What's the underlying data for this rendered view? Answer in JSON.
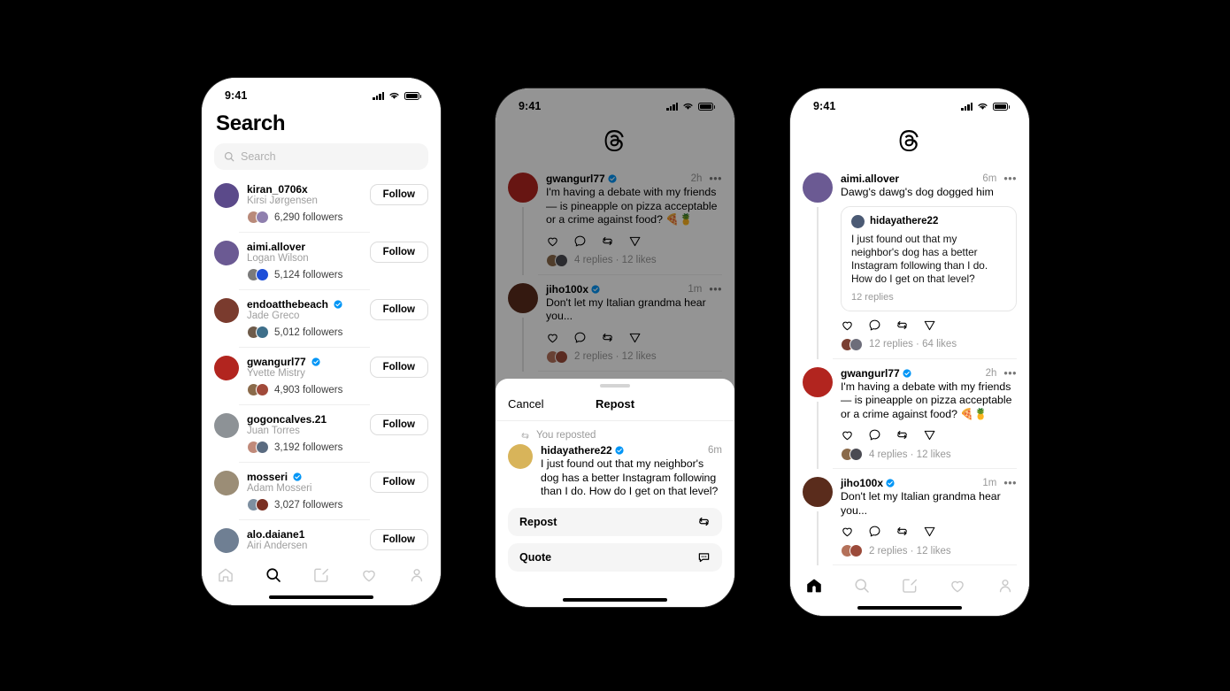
{
  "meta": {
    "app_name": "Threads",
    "background": "#000000",
    "accent_verified": "#0095f6"
  },
  "status_bar": {
    "time": "9:41",
    "cellular": "signal-bars",
    "wifi": "wifi",
    "battery": "battery-full"
  },
  "phone1": {
    "screen_title": "Search",
    "search": {
      "placeholder": "Search",
      "value": ""
    },
    "results": [
      {
        "username": "kiran_0706x",
        "fullname": "Kirsi Jørgensen",
        "followers": "6,290 followers",
        "verified": false,
        "follow_label": "Follow",
        "avatar": "#5b4a8a",
        "face1": "#b98a7a",
        "face2": "#8f7fae"
      },
      {
        "username": "aimi.allover",
        "fullname": "Logan Wilson",
        "followers": "5,124 followers",
        "verified": false,
        "follow_label": "Follow",
        "avatar": "#6b5a93",
        "face1": "#7a7a7a",
        "face2": "#1d4ed8"
      },
      {
        "username": "endoatthebeach",
        "fullname": "Jade Greco",
        "followers": "5,012 followers",
        "verified": true,
        "follow_label": "Follow",
        "avatar": "#7a3b2e",
        "face1": "#6e5b4a",
        "face2": "#3e6f8a"
      },
      {
        "username": "gwangurl77",
        "fullname": "Yvette Mistry",
        "followers": "4,903 followers",
        "verified": true,
        "follow_label": "Follow",
        "avatar": "#b2251f",
        "face1": "#8a6a4a",
        "face2": "#a14a3a"
      },
      {
        "username": "gogoncalves.21",
        "fullname": "Juan Torres",
        "followers": "3,192 followers",
        "verified": false,
        "follow_label": "Follow",
        "avatar": "#8d9296",
        "face1": "#c08a7a",
        "face2": "#5a6b80"
      },
      {
        "username": "mosseri",
        "fullname": "Adam Mosseri",
        "followers": "3,027 followers",
        "verified": true,
        "follow_label": "Follow",
        "avatar": "#9b8d76",
        "face1": "#7d8fa0",
        "face2": "#7a2f22"
      },
      {
        "username": "alo.daiane1",
        "fullname": "Airi Andersen",
        "followers": "",
        "verified": false,
        "follow_label": "Follow",
        "avatar": "#6f7f93",
        "face1": "#999",
        "face2": "#888"
      }
    ],
    "tabbar": [
      "home-icon",
      "search-icon",
      "compose-icon",
      "activity-icon",
      "profile-icon"
    ],
    "active_tab": "search-icon"
  },
  "phone2": {
    "logo": "threads-logo",
    "posts": [
      {
        "username": "gwangurl77",
        "verified": true,
        "time": "2h",
        "text": "I'm having a debate with my friends — is pineapple on pizza acceptable or a crime against food? 🍕🍍",
        "stats": "4 replies · 12 likes",
        "avatar": "#b2251f",
        "face1": "#8a6a4a",
        "face2": "#4a4a52"
      },
      {
        "username": "jiho100x",
        "verified": true,
        "time": "1m",
        "text": "Don't let my Italian grandma hear you...",
        "stats": "2 replies · 12 likes",
        "avatar": "#5a2c1c",
        "face1": "#b4715a",
        "face2": "#9b4a3a"
      },
      {
        "username": "hidayathere22",
        "verified": false,
        "time": "6m",
        "text": "I just found out that my neighbor's dog has a",
        "stats": "",
        "avatar": "#2f3b52",
        "face1": "#888",
        "face2": "#888"
      }
    ],
    "sheet": {
      "cancel_label": "Cancel",
      "title": "Repost",
      "reposted_label": "You reposted",
      "post": {
        "username": "hidayathere22",
        "verified": true,
        "time": "6m",
        "text": "I just found out that my neighbor's dog has a better Instagram following than I do. How do I get on that level?",
        "avatar": "#d8b45a"
      },
      "options": [
        {
          "label": "Repost",
          "icon": "repost-icon"
        },
        {
          "label": "Quote",
          "icon": "quote-icon"
        }
      ]
    }
  },
  "phone3": {
    "logo": "threads-logo",
    "posts": [
      {
        "username": "aimi.allover",
        "verified": false,
        "time": "6m",
        "text": "Dawg's dawg's dog dogged him",
        "stats": "12 replies · 64 likes",
        "avatar": "#6b5a93",
        "face1": "#7a3f32",
        "face2": "#6d6d7a",
        "quote": {
          "username": "hidayathere22",
          "text": "I just found out that my neighbor's dog has a better Instagram following than I do. How do I get on that level?",
          "replies": "12 replies",
          "avatar": "#4b5a74"
        }
      },
      {
        "username": "gwangurl77",
        "verified": true,
        "time": "2h",
        "text": "I'm having a debate with my friends — is pineapple on pizza acceptable or a crime against food? 🍕🍍",
        "stats": "4 replies · 12 likes",
        "avatar": "#b2251f",
        "face1": "#8a6a4a",
        "face2": "#4a4a52"
      },
      {
        "username": "jiho100x",
        "verified": true,
        "time": "1m",
        "text": "Don't let my Italian grandma hear you...",
        "stats": "2 replies · 12 likes",
        "avatar": "#5a2c1c",
        "face1": "#b4715a",
        "face2": "#9b4a3a"
      },
      {
        "username": "hidayathere22",
        "verified": false,
        "time": "6m",
        "text": "I just found out that my neighbor's dog has a better Instagram following than I do. How do I",
        "stats": "",
        "avatar": "#d8b45a",
        "face1": "#888",
        "face2": "#888"
      }
    ],
    "tabbar": [
      "home-icon",
      "search-icon",
      "compose-icon",
      "activity-icon",
      "profile-icon"
    ],
    "active_tab": "home-icon"
  }
}
